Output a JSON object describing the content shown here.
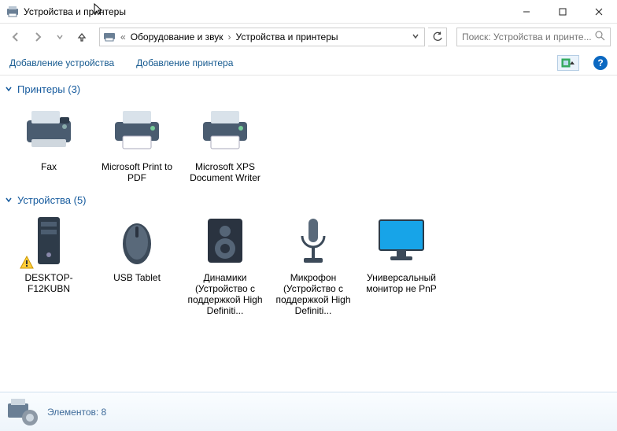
{
  "window": {
    "title": "Устройства и принтеры"
  },
  "breadcrumb": {
    "part1": "Оборудование и звук",
    "part2": "Устройства и принтеры"
  },
  "search": {
    "placeholder": "Поиск: Устройства и принте..."
  },
  "commands": {
    "add_device": "Добавление устройства",
    "add_printer": "Добавление принтера"
  },
  "help": {
    "label": "?"
  },
  "groups": {
    "printers": {
      "header": "Принтеры (3)",
      "items": [
        {
          "label": "Fax"
        },
        {
          "label": "Microsoft Print to PDF"
        },
        {
          "label": "Microsoft XPS Document Writer"
        }
      ]
    },
    "devices": {
      "header": "Устройства (5)",
      "items": [
        {
          "label": "DESKTOP-F12KUBN"
        },
        {
          "label": "USB Tablet"
        },
        {
          "label": "Динамики (Устройство с поддержкой High Definiti..."
        },
        {
          "label": "Микрофон (Устройство с поддержкой High Definiti..."
        },
        {
          "label": "Универсальный монитор не PnP"
        }
      ]
    }
  },
  "statusbar": {
    "text": "Элементов: 8"
  }
}
